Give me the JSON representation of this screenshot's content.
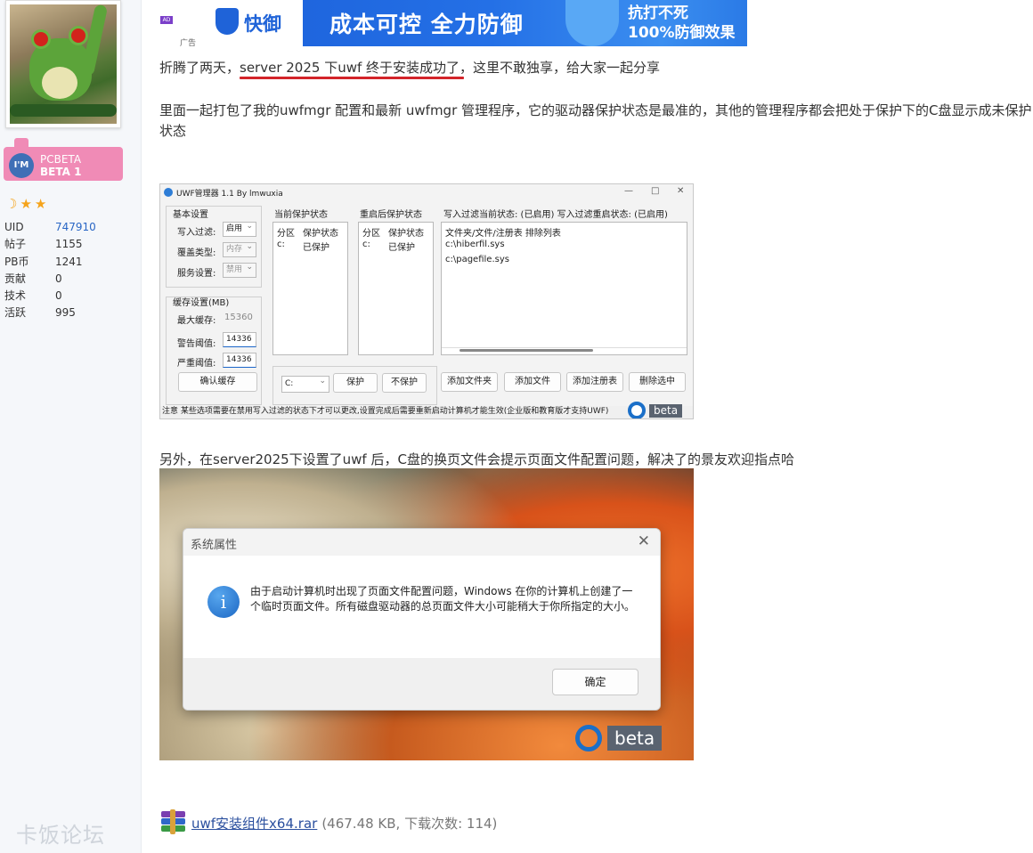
{
  "sidebar": {
    "badge_line1": "PCBETA",
    "badge_line2": "BETA 1",
    "badge_circle": "I'M",
    "stars": "☽★★",
    "stats": [
      {
        "label": "UID",
        "value": "747910"
      },
      {
        "label": "帖子",
        "value": "1155"
      },
      {
        "label": "PB币",
        "value": "1241"
      },
      {
        "label": "贡献",
        "value": "0"
      },
      {
        "label": "技术",
        "value": "0"
      },
      {
        "label": "活跃",
        "value": "995"
      }
    ],
    "watermark": "卡饭论坛"
  },
  "ad": {
    "tag": "AD",
    "brand": "快御",
    "small_label": "广告",
    "headline": "成本可控 全力防御",
    "right_line1": "抗打不死",
    "right_line2": "100%防御效果"
  },
  "post": {
    "p1_a": "折腾了两天，",
    "p1_b": "server 2025 下uwf 终于安装成功了",
    "p1_c": "，这里不敢独享，给大家一起分享",
    "p2": "里面一起打包了我的uwfmgr 配置和最新 uwfmgr 管理程序，它的驱动器保护状态是最准的，其他的管理程序都会把处于保护下的C盘显示成未保护状态",
    "p3": "另外，在server2025下设置了uwf 后，C盘的换页文件会提示页面文件配置问题，解决了的景友欢迎指点哈"
  },
  "uwf_window": {
    "title": "UWF管理器 1.1    By lmwuxia",
    "controls": [
      "—",
      "□",
      "✕"
    ],
    "basic_group": "基本设置",
    "write_filter_label": "写入过滤:",
    "write_filter_value": "启用",
    "overlay_type_label": "覆盖类型:",
    "overlay_type_value": "内存",
    "service_label": "服务设置:",
    "service_value": "禁用",
    "cache_group": "缓存设置(MB)",
    "max_cache_label": "最大缓存:",
    "max_cache_value": "15360",
    "warn_label": "警告阈值:",
    "warn_value": "14336",
    "severe_label": "严重阈值:",
    "severe_value": "14336",
    "confirm_cache": "确认缓存",
    "current_header": "当前保护状态",
    "restart_header": "重启后保护状态",
    "filter_header": "写入过滤当前状态: (已启用)   写入过滤重启状态: (已启用)",
    "col_partition": "分区",
    "col_status": "保护状态",
    "row_drive": "c:",
    "row_status": "已保护",
    "exclusion_header": "文件夹/文件/注册表 排除列表",
    "exclusions": [
      "c:\\hiberfil.sys",
      "c:\\pagefile.sys"
    ],
    "drive_select": "C:",
    "btn_protect": "保护",
    "btn_unprotect": "不保护",
    "btn_add_folder": "添加文件夹",
    "btn_add_file": "添加文件",
    "btn_add_reg": "添加注册表",
    "btn_delete": "删除选中",
    "status_bar": "注意 某些选项需要在禁用写入过滤的状态下才可以更改,设置完成后需要重新启动计算机才能生效(企业版和教育版才支持UWF)",
    "logo_text": "beta"
  },
  "dialog": {
    "title": "系统属性",
    "close": "✕",
    "info_glyph": "i",
    "message": "由于启动计算机时出现了页面文件配置问题，Windows 在你的计算机上创建了一个临时页面文件。所有磁盘驱动器的总页面文件大小可能稍大于你所指定的大小。",
    "ok": "确定",
    "logo_text": "beta"
  },
  "attachment": {
    "filename": "uwf安装组件x64.rar",
    "meta": "(467.48 KB, 下载次数: 114)",
    "icon": "winrar-archive-icon"
  }
}
